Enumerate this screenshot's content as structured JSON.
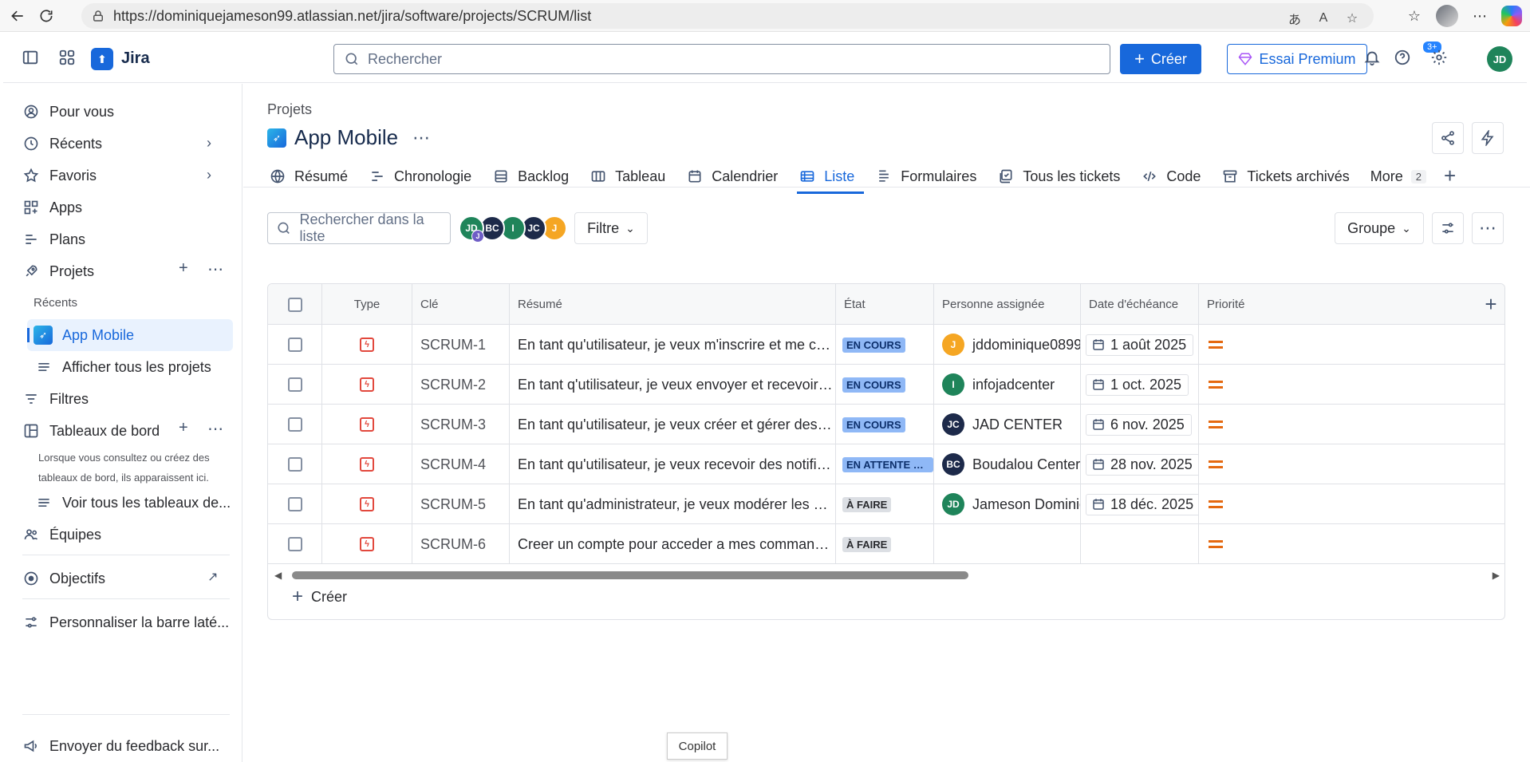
{
  "browser": {
    "url": "https://dominiquejameson99.atlassian.net/jira/software/projects/SCRUM/list"
  },
  "topnav": {
    "app_name": "Jira",
    "search_placeholder": "Rechercher",
    "create_label": "Créer",
    "premium_label": "Essai Premium",
    "help_badge": "3+",
    "user_initials": "JD"
  },
  "sidebar": {
    "pour_vous": "Pour vous",
    "recents": "Récents",
    "favoris": "Favoris",
    "apps": "Apps",
    "plans": "Plans",
    "projets": "Projets",
    "recents_sub": "Récents",
    "app_mobile": "App Mobile",
    "afficher_projets": "Afficher tous les projets",
    "filtres": "Filtres",
    "tableaux": "Tableaux de bord",
    "tableaux_note": "Lorsque vous consultez ou créez des tableaux de bord, ils apparaissent ici.",
    "voir_tableaux": "Voir tous les tableaux de...",
    "equipes": "Équipes",
    "objectifs": "Objectifs",
    "personnaliser": "Personnaliser la barre laté...",
    "feedback": "Envoyer du feedback sur..."
  },
  "main": {
    "breadcrumb": "Projets",
    "project_name": "App Mobile",
    "tabs": [
      {
        "label": "Résumé",
        "icon": "globe-icon"
      },
      {
        "label": "Chronologie",
        "icon": "timeline-icon"
      },
      {
        "label": "Backlog",
        "icon": "backlog-icon"
      },
      {
        "label": "Tableau",
        "icon": "board-icon"
      },
      {
        "label": "Calendrier",
        "icon": "calendar-icon"
      },
      {
        "label": "Liste",
        "icon": "list-icon",
        "active": true
      },
      {
        "label": "Formulaires",
        "icon": "form-icon"
      },
      {
        "label": "Tous les tickets",
        "icon": "tickets-icon"
      },
      {
        "label": "Code",
        "icon": "code-icon"
      },
      {
        "label": "Tickets archivés",
        "icon": "archive-icon"
      },
      {
        "label": "More",
        "icon": "more-icon",
        "count": "2"
      }
    ],
    "list_search_placeholder": "Rechercher dans la liste",
    "filter_label": "Filtre",
    "group_label": "Groupe",
    "avatars": [
      {
        "initials": "JD",
        "color": "#1f845a",
        "sub": "J"
      },
      {
        "initials": "BC",
        "color": "#1d2a4a"
      },
      {
        "initials": "I",
        "color": "#1f845a"
      },
      {
        "initials": "JC",
        "color": "#1d2a4a"
      },
      {
        "initials": "J",
        "color": "#f5a623"
      }
    ]
  },
  "table": {
    "headers": {
      "type": "Type",
      "key": "Clé",
      "summary": "Résumé",
      "status": "État",
      "assignee": "Personne assignée",
      "due": "Date d'échéance",
      "priority": "Priorité"
    },
    "rows": [
      {
        "key": "SCRUM-1",
        "summary": "En tant qu'utilisateur, je veux m'inscrire et me connecter à l'ap...",
        "status": "EN COURS",
        "status_kind": "progress",
        "assignee": "jddominique0899",
        "initials": "J",
        "av_color": "#f5a623",
        "due": "1 août 2025"
      },
      {
        "key": "SCRUM-2",
        "summary": "En tant q'utilisateur, je veux envoyer et recevoir des message...",
        "status": "EN COURS",
        "status_kind": "progress",
        "assignee": "infojadcenter",
        "initials": "I",
        "av_color": "#1f845a",
        "due": "1 oct. 2025"
      },
      {
        "key": "SCRUM-3",
        "summary": "En tant qu'utilisateur, je veux créer et gérer des groupes de d...",
        "status": "EN COURS",
        "status_kind": "progress",
        "assignee": "JAD CENTER",
        "initials": "JC",
        "av_color": "#1d2a4a",
        "due": "6 nov. 2025"
      },
      {
        "key": "SCRUM-4",
        "summary": "En tant qu'utilisateur, je veux recevoir des notifications push ...",
        "status": "EN ATTENTE DU ...",
        "status_kind": "wait",
        "assignee": "Boudalou Center",
        "initials": "BC",
        "av_color": "#1d2a4a",
        "due": "28 nov. 2025"
      },
      {
        "key": "SCRUM-5",
        "summary": "En tant qu'administrateur, je veux modérer les discussions po...",
        "status": "À FAIRE",
        "status_kind": "todo",
        "assignee": "Jameson Dominique",
        "initials": "JD",
        "av_color": "#1f845a",
        "due": "18 déc. 2025"
      },
      {
        "key": "SCRUM-6",
        "summary": "Creer un compte pour acceder a mes commandes.",
        "status": "À FAIRE",
        "status_kind": "todo",
        "assignee": "",
        "initials": "",
        "av_color": "",
        "due": ""
      }
    ],
    "create_label": "Créer"
  },
  "copilot_tooltip": "Copilot"
}
